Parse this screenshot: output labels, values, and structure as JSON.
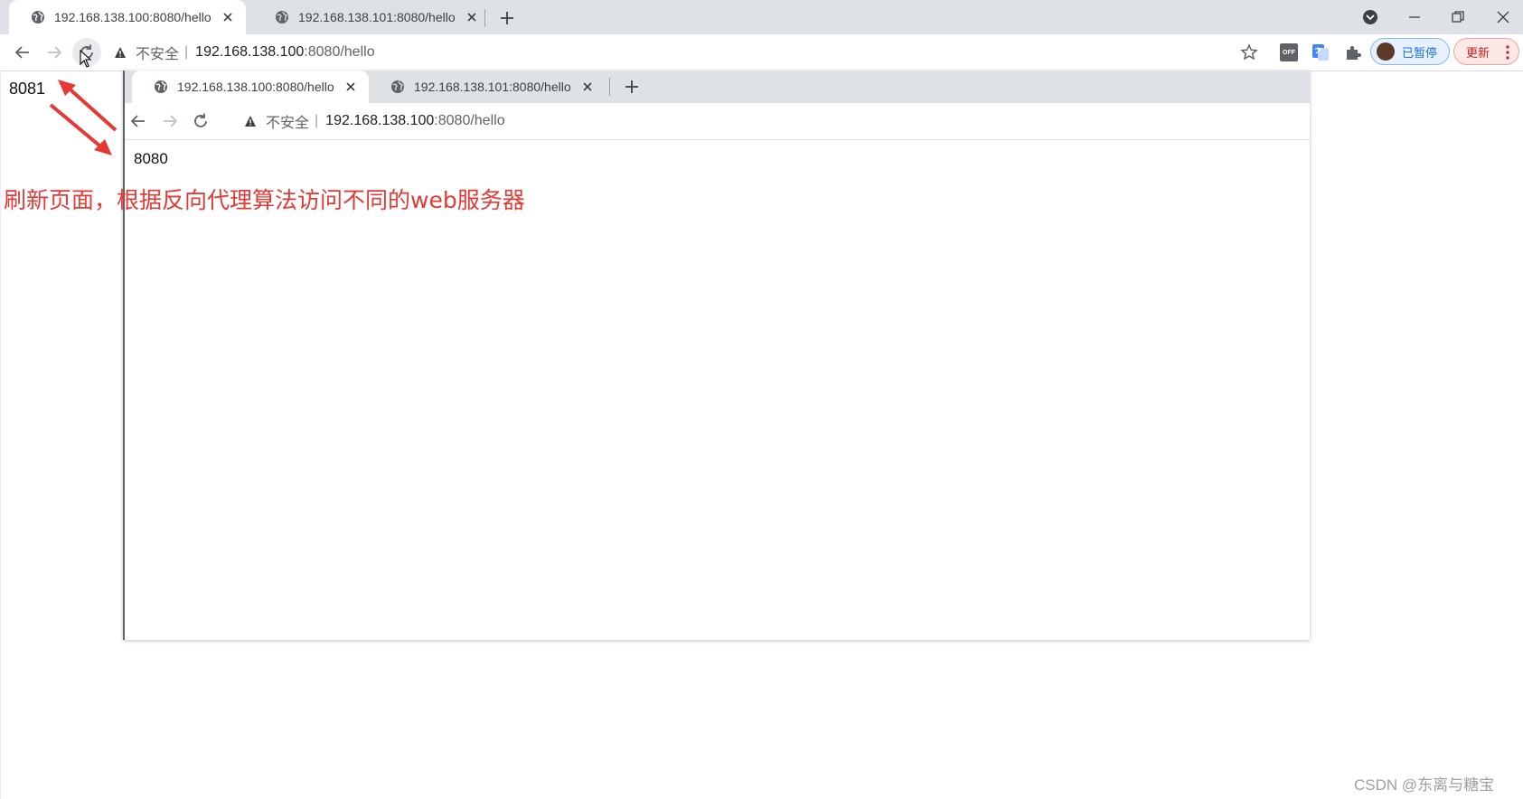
{
  "outer": {
    "tabs": [
      {
        "label": "192.168.138.100:8080/hello",
        "active": true
      },
      {
        "label": "192.168.138.101:8080/hello",
        "active": false
      }
    ],
    "omnibox": {
      "security_label": "不安全",
      "separator": "|",
      "host": "192.168.138.100",
      "path": ":8080/hello"
    },
    "profile_label": "已暂停",
    "update_label": "更新",
    "extension_off_label": "OFF",
    "page_text": "8081"
  },
  "inner": {
    "tabs": [
      {
        "label": "192.168.138.100:8080/hello",
        "active": true
      },
      {
        "label": "192.168.138.101:8080/hello",
        "active": false
      }
    ],
    "omnibox": {
      "security_label": "不安全",
      "separator": "|",
      "host": "192.168.138.100",
      "path": ":8080/hello"
    },
    "page_text": "8080"
  },
  "annotation": "刷新页面，根据反向代理算法访问不同的web服务器",
  "watermark": "CSDN @东离与糖宝",
  "colors": {
    "tabstrip": "#dee1e6",
    "annotation": "#e53935",
    "arrow": "#e53935"
  }
}
